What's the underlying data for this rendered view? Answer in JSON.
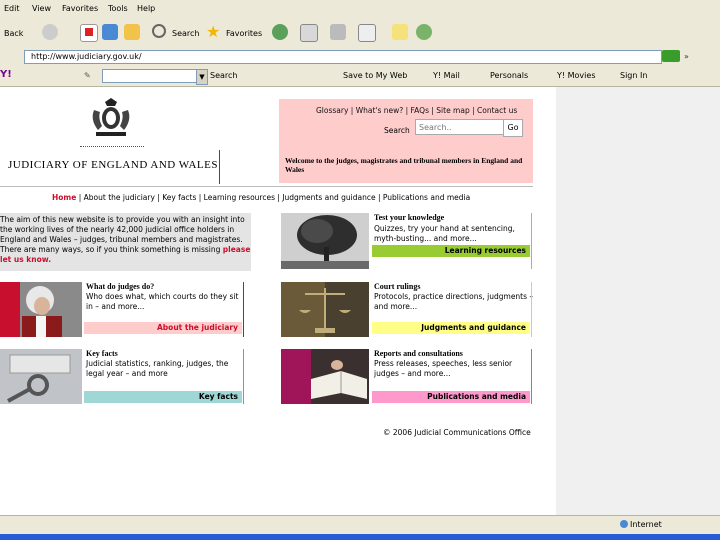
{
  "browser": {
    "menu": [
      "Edit",
      "View",
      "Favorites",
      "Tools",
      "Help"
    ],
    "toolbar": {
      "back": "Back",
      "search": "Search",
      "favorites": "Favorites"
    },
    "address": "http://www.judiciary.gov.uk/",
    "yahoo": {
      "search": "Search",
      "save": "Save to My Web",
      "mail": "Y! Mail",
      "personals": "Personals",
      "movies": "Y! Movies",
      "signin": "Sign In"
    },
    "status": "Internet"
  },
  "header": {
    "site_title": "JUDICIARY OF ENGLAND AND WALES",
    "top_links": "Glossary | What's new? | FAQs | Site map | Contact us",
    "search_label": "Search",
    "search_placeholder": "Search..",
    "search_go": "Go",
    "welcome": "Welcome to the judges, magistrates and tribunal members in England and Wales"
  },
  "nav": {
    "home": "Home",
    "rest": "| About the judiciary | Key facts | Learning resources | Judgments and guidance | Publications and media"
  },
  "intro": {
    "text": "The aim of this new website is to provide you with an insight into the working lives of the nearly 42,000 judicial office holders in England and Wales – judges, tribunal members and magistrates. There are many ways, so if you think something is missing",
    "link": "please let us know."
  },
  "cards": {
    "test": {
      "title": "Test your knowledge",
      "text": "Quizzes, try your hand at sentencing, myth-busting... and more...",
      "link": "Learning resources"
    },
    "judges": {
      "title": "What do judges do?",
      "text": "Who does what, which courts do they sit in – and more...",
      "link": "About the judiciary"
    },
    "rulings": {
      "title": "Court rulings",
      "text": "Protocols, practice directions, judgments – and more...",
      "link": "Judgments and guidance"
    },
    "facts": {
      "title": "Key facts",
      "text": "Judicial statistics, ranking, judges, the legal year – and more",
      "link": "Key facts"
    },
    "reports": {
      "title": "Reports and consultations",
      "text": "Press releases, speeches, less senior judges – and more...",
      "link": "Publications and media"
    }
  },
  "footer": {
    "copyright": "© 2006 Judicial Communications Office"
  },
  "colors": {
    "pink": "#ffcccc",
    "green": "#99cc33",
    "red": "#c8102e",
    "yellow": "#ffff88",
    "teal": "#9fd6d6",
    "magenta": "#ff99cc"
  }
}
